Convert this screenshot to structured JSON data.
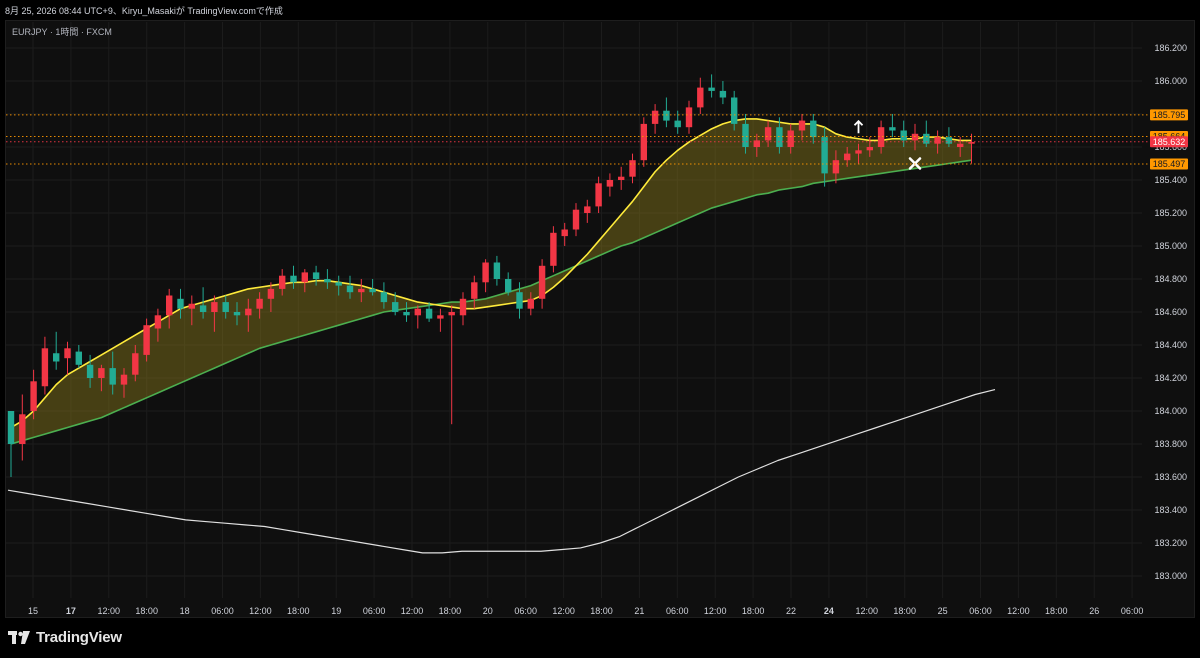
{
  "header": {
    "caption": "8月 25, 2026 08:44 UTC+9、Kiryu_Masakiが TradingView.comで作成"
  },
  "chart_header": {
    "symbol": "EURJPY · 1時間 · FXCM"
  },
  "footer": {
    "brand": "TradingView",
    "logo_icon": "tradingview-logo-icon"
  },
  "colors": {
    "up": "#f23645",
    "down": "#22ab94",
    "ma_fast": "#ffeb3b",
    "ma_mid": "#4caf50",
    "ma_slow": "#e0e0e0",
    "band_fill": "#8a7a1a",
    "price_tag_orange": "#ff9800",
    "price_tag_red": "#f23645",
    "grid": "#1c1c1c",
    "background": "#0f0f0f"
  },
  "chart_data": {
    "type": "candlestick",
    "y_axis": {
      "min": 182.9,
      "max": 186.3,
      "ticks": [
        "186.200",
        "186.000",
        "185.800",
        "185.600",
        "185.400",
        "185.200",
        "185.000",
        "184.800",
        "184.600",
        "184.400",
        "184.200",
        "184.000",
        "183.800",
        "183.600",
        "183.400",
        "183.200",
        "183.000"
      ]
    },
    "x_axis": {
      "ticks": [
        "15",
        "17",
        "12:00",
        "18:00",
        "18",
        "06:00",
        "12:00",
        "18:00",
        "19",
        "06:00",
        "12:00",
        "18:00",
        "20",
        "06:00",
        "12:00",
        "18:00",
        "21",
        "06:00",
        "12:00",
        "18:00",
        "22",
        "24",
        "12:00",
        "18:00",
        "25",
        "06:00",
        "12:00",
        "18:00",
        "26",
        "06:00"
      ]
    },
    "price_tags": [
      {
        "label": "185.795",
        "value": 185.795,
        "style": "orange"
      },
      {
        "label": "185.664",
        "value": 185.664,
        "style": "orange"
      },
      {
        "label": "185.632",
        "value": 185.632,
        "style": "red"
      },
      {
        "label": "185.497",
        "value": 185.497,
        "style": "orange"
      }
    ],
    "candles": [
      [
        184.0,
        184.0,
        183.6,
        183.8
      ],
      [
        183.8,
        184.1,
        183.7,
        183.98
      ],
      [
        184.0,
        184.25,
        183.95,
        184.18
      ],
      [
        184.15,
        184.45,
        184.1,
        184.38
      ],
      [
        184.35,
        184.48,
        184.25,
        184.3
      ],
      [
        184.32,
        184.42,
        184.22,
        184.38
      ],
      [
        184.36,
        184.4,
        184.26,
        184.28
      ],
      [
        184.28,
        184.34,
        184.14,
        184.2
      ],
      [
        184.2,
        184.28,
        184.12,
        184.26
      ],
      [
        184.26,
        184.36,
        184.1,
        184.16
      ],
      [
        184.16,
        184.26,
        184.08,
        184.22
      ],
      [
        184.22,
        184.4,
        184.18,
        184.35
      ],
      [
        184.34,
        184.56,
        184.3,
        184.52
      ],
      [
        184.5,
        184.62,
        184.42,
        184.58
      ],
      [
        184.58,
        184.74,
        184.5,
        184.7
      ],
      [
        184.68,
        184.74,
        184.56,
        184.62
      ],
      [
        184.62,
        184.7,
        184.52,
        184.65
      ],
      [
        184.64,
        184.75,
        184.56,
        184.6
      ],
      [
        184.6,
        184.7,
        184.48,
        184.66
      ],
      [
        184.66,
        184.7,
        184.56,
        184.6
      ],
      [
        184.6,
        184.66,
        184.52,
        184.58
      ],
      [
        184.58,
        184.68,
        184.48,
        184.62
      ],
      [
        184.62,
        184.72,
        184.56,
        184.68
      ],
      [
        184.68,
        184.78,
        184.6,
        184.74
      ],
      [
        184.74,
        184.86,
        184.7,
        184.82
      ],
      [
        184.82,
        184.88,
        184.74,
        184.78
      ],
      [
        184.78,
        184.86,
        184.72,
        184.84
      ],
      [
        184.84,
        184.88,
        184.76,
        184.8
      ],
      [
        184.8,
        184.86,
        184.74,
        184.78
      ],
      [
        184.78,
        184.82,
        184.7,
        184.76
      ],
      [
        184.76,
        184.82,
        184.68,
        184.72
      ],
      [
        184.72,
        184.8,
        184.66,
        184.74
      ],
      [
        184.74,
        184.8,
        184.7,
        184.72
      ],
      [
        184.72,
        184.78,
        184.62,
        184.66
      ],
      [
        184.66,
        184.72,
        184.58,
        184.6
      ],
      [
        184.6,
        184.66,
        184.54,
        184.58
      ],
      [
        184.58,
        184.64,
        184.5,
        184.62
      ],
      [
        184.62,
        184.66,
        184.54,
        184.56
      ],
      [
        184.56,
        184.62,
        184.48,
        184.58
      ],
      [
        184.58,
        184.64,
        183.92,
        184.6
      ],
      [
        184.58,
        184.72,
        184.52,
        184.68
      ],
      [
        184.68,
        184.82,
        184.62,
        184.78
      ],
      [
        184.78,
        184.92,
        184.72,
        184.9
      ],
      [
        184.9,
        184.94,
        184.76,
        184.8
      ],
      [
        184.8,
        184.84,
        184.7,
        184.72
      ],
      [
        184.72,
        184.78,
        184.56,
        184.62
      ],
      [
        184.62,
        184.72,
        184.58,
        184.68
      ],
      [
        184.68,
        184.92,
        184.62,
        184.88
      ],
      [
        184.88,
        185.12,
        184.84,
        185.08
      ],
      [
        185.06,
        185.14,
        185.0,
        185.1
      ],
      [
        185.1,
        185.26,
        185.06,
        185.22
      ],
      [
        185.2,
        185.28,
        185.14,
        185.24
      ],
      [
        185.24,
        185.42,
        185.2,
        185.38
      ],
      [
        185.36,
        185.44,
        185.3,
        185.4
      ],
      [
        185.4,
        185.48,
        185.34,
        185.42
      ],
      [
        185.42,
        185.56,
        185.38,
        185.52
      ],
      [
        185.52,
        185.78,
        185.48,
        185.74
      ],
      [
        185.74,
        185.86,
        185.68,
        185.82
      ],
      [
        185.82,
        185.9,
        185.72,
        185.76
      ],
      [
        185.76,
        185.82,
        185.68,
        185.72
      ],
      [
        185.72,
        185.88,
        185.68,
        185.84
      ],
      [
        185.84,
        186.02,
        185.8,
        185.96
      ],
      [
        185.96,
        186.04,
        185.9,
        185.94
      ],
      [
        185.94,
        186.0,
        185.86,
        185.9
      ],
      [
        185.9,
        185.94,
        185.7,
        185.74
      ],
      [
        185.74,
        185.8,
        185.56,
        185.6
      ],
      [
        185.6,
        185.68,
        185.54,
        185.64
      ],
      [
        185.64,
        185.76,
        185.6,
        185.72
      ],
      [
        185.72,
        185.78,
        185.56,
        185.6
      ],
      [
        185.6,
        185.74,
        185.56,
        185.7
      ],
      [
        185.7,
        185.8,
        185.64,
        185.76
      ],
      [
        185.76,
        185.8,
        185.62,
        185.66
      ],
      [
        185.66,
        185.72,
        185.36,
        185.44
      ],
      [
        185.44,
        185.58,
        185.38,
        185.52
      ],
      [
        185.52,
        185.6,
        185.48,
        185.56
      ],
      [
        185.56,
        185.62,
        185.5,
        185.58
      ],
      [
        185.58,
        185.66,
        185.54,
        185.6
      ],
      [
        185.6,
        185.76,
        185.56,
        185.72
      ],
      [
        185.72,
        185.8,
        185.66,
        185.7
      ],
      [
        185.7,
        185.76,
        185.6,
        185.64
      ],
      [
        185.64,
        185.74,
        185.58,
        185.68
      ],
      [
        185.68,
        185.76,
        185.6,
        185.62
      ],
      [
        185.62,
        185.7,
        185.56,
        185.66
      ],
      [
        185.66,
        185.72,
        185.6,
        185.62
      ],
      [
        185.6,
        185.66,
        185.54,
        185.62
      ],
      [
        185.62,
        185.68,
        185.5,
        185.63
      ]
    ],
    "ma_fast": [
      183.9,
      183.94,
      184.0,
      184.08,
      184.16,
      184.22,
      184.26,
      184.3,
      184.34,
      184.38,
      184.42,
      184.46,
      184.5,
      184.54,
      184.58,
      184.62,
      184.64,
      184.66,
      184.68,
      184.7,
      184.72,
      184.74,
      184.75,
      184.76,
      184.77,
      184.78,
      184.78,
      184.79,
      184.79,
      184.78,
      184.77,
      184.76,
      184.74,
      184.72,
      184.7,
      184.68,
      184.66,
      184.65,
      184.64,
      184.63,
      184.62,
      184.62,
      184.63,
      184.64,
      184.65,
      184.66,
      184.67,
      184.7,
      184.75,
      184.81,
      184.88,
      184.95,
      185.03,
      185.11,
      185.19,
      185.27,
      185.36,
      185.45,
      185.52,
      185.58,
      185.63,
      185.67,
      185.71,
      185.74,
      185.76,
      185.77,
      185.77,
      185.76,
      185.75,
      185.74,
      185.74,
      185.74,
      185.72,
      185.68,
      185.66,
      185.65,
      185.64,
      185.64,
      185.65,
      185.65,
      185.65,
      185.66,
      185.66,
      185.65,
      185.64,
      185.64
    ],
    "ma_mid": [
      183.8,
      183.82,
      183.84,
      183.86,
      183.88,
      183.9,
      183.92,
      183.94,
      183.96,
      183.99,
      184.02,
      184.05,
      184.08,
      184.11,
      184.14,
      184.17,
      184.2,
      184.23,
      184.26,
      184.29,
      184.32,
      184.35,
      184.38,
      184.4,
      184.42,
      184.44,
      184.46,
      184.48,
      184.5,
      184.52,
      184.54,
      184.56,
      184.58,
      184.6,
      184.61,
      184.62,
      184.63,
      184.64,
      184.65,
      184.66,
      184.66,
      184.67,
      184.68,
      184.7,
      184.72,
      184.74,
      184.76,
      184.79,
      184.82,
      184.85,
      184.88,
      184.91,
      184.94,
      184.97,
      185.0,
      185.02,
      185.05,
      185.08,
      185.11,
      185.14,
      185.17,
      185.2,
      185.23,
      185.25,
      185.27,
      185.29,
      185.31,
      185.32,
      185.34,
      185.35,
      185.36,
      185.38,
      185.39,
      185.4,
      185.41,
      185.42,
      185.43,
      185.44,
      185.45,
      185.46,
      185.47,
      185.48,
      185.49,
      185.5,
      185.51,
      185.52
    ],
    "ma_slow": [
      183.52,
      183.5,
      183.48,
      183.46,
      183.44,
      183.42,
      183.4,
      183.38,
      183.36,
      183.34,
      183.33,
      183.32,
      183.31,
      183.3,
      183.28,
      183.26,
      183.24,
      183.22,
      183.2,
      183.18,
      183.16,
      183.14,
      183.14,
      183.15,
      183.15,
      183.15,
      183.15,
      183.15,
      183.16,
      183.17,
      183.2,
      183.24,
      183.3,
      183.36,
      183.42,
      183.48,
      183.54,
      183.6,
      183.65,
      183.7,
      183.74,
      183.78,
      183.82,
      183.86,
      183.9,
      183.94,
      183.98,
      184.02,
      184.06,
      184.1,
      184.13
    ],
    "markers": [
      {
        "type": "buy-arrow",
        "index": 75,
        "value": 185.72
      },
      {
        "type": "exit-x",
        "index": 80,
        "value": 185.5
      }
    ]
  }
}
